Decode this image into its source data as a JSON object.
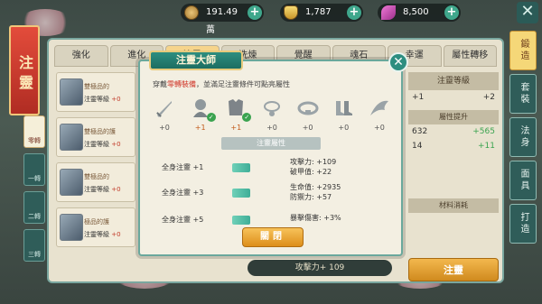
{
  "currency": {
    "copper": "191.49萬",
    "gold": "1,787",
    "feather": "8,500"
  },
  "left_tag": "注靈",
  "left_tabs": [
    "零轉",
    "一轉",
    "二轉",
    "三轉"
  ],
  "tabs": [
    "強化",
    "進化",
    "注靈",
    "洗煉",
    "覺醒",
    "魂石",
    "幸運",
    "屬性轉移"
  ],
  "list": [
    {
      "name": "雙極品的",
      "level_label": "注靈等級",
      "level_value": "+0"
    },
    {
      "name": "雙極品的護",
      "level_label": "注靈等級",
      "level_value": "+0"
    },
    {
      "name": "雙極品的",
      "level_label": "注靈等級",
      "level_value": "+0"
    },
    {
      "name": "極品的護",
      "level_label": "注靈等級",
      "level_value": "+0"
    }
  ],
  "right": {
    "header": "注靈等級",
    "row1_left": "+1",
    "row1_right": "+2",
    "attr_header": "屬性提升",
    "row2_left": "632",
    "row2_right": "+565",
    "row3_left": "14",
    "row3_right": "+11",
    "mat_header": "材料消耗",
    "cta": "注靈"
  },
  "bottom_stat": "攻擊力+ 109",
  "side_menu": [
    "鍛造",
    "套裝",
    "法身",
    "面具",
    "打造"
  ],
  "dialog": {
    "title": "注靈大師",
    "hint_prefix": "穿戴",
    "hint_red": "零轉裝備",
    "hint_suffix": "，並滿足注靈條件可點亮屬性",
    "slots": [
      {
        "icon": "sword-icon",
        "value": "+0",
        "checked": false
      },
      {
        "icon": "helmet-icon",
        "value": "+1",
        "checked": true
      },
      {
        "icon": "armor-icon",
        "value": "+1",
        "checked": true
      },
      {
        "icon": "necklace-icon",
        "value": "+0",
        "checked": false
      },
      {
        "icon": "belt-icon",
        "value": "+0",
        "checked": false
      },
      {
        "icon": "boots-icon",
        "value": "+0",
        "checked": false
      },
      {
        "icon": "wing-icon",
        "value": "+0",
        "checked": false
      }
    ],
    "section_header": "注靈屬性",
    "tiers": [
      {
        "label": "全身注靈 +1",
        "stats": [
          "攻擊力: +109",
          "破甲值: +22"
        ]
      },
      {
        "label": "全身注靈 +3",
        "stats": [
          "生命值: +2935",
          "防禦力: +57"
        ]
      },
      {
        "label": "全身注靈 +5",
        "stats": [
          "暴擊傷害: +3%"
        ]
      }
    ],
    "close_label": "關閉"
  }
}
